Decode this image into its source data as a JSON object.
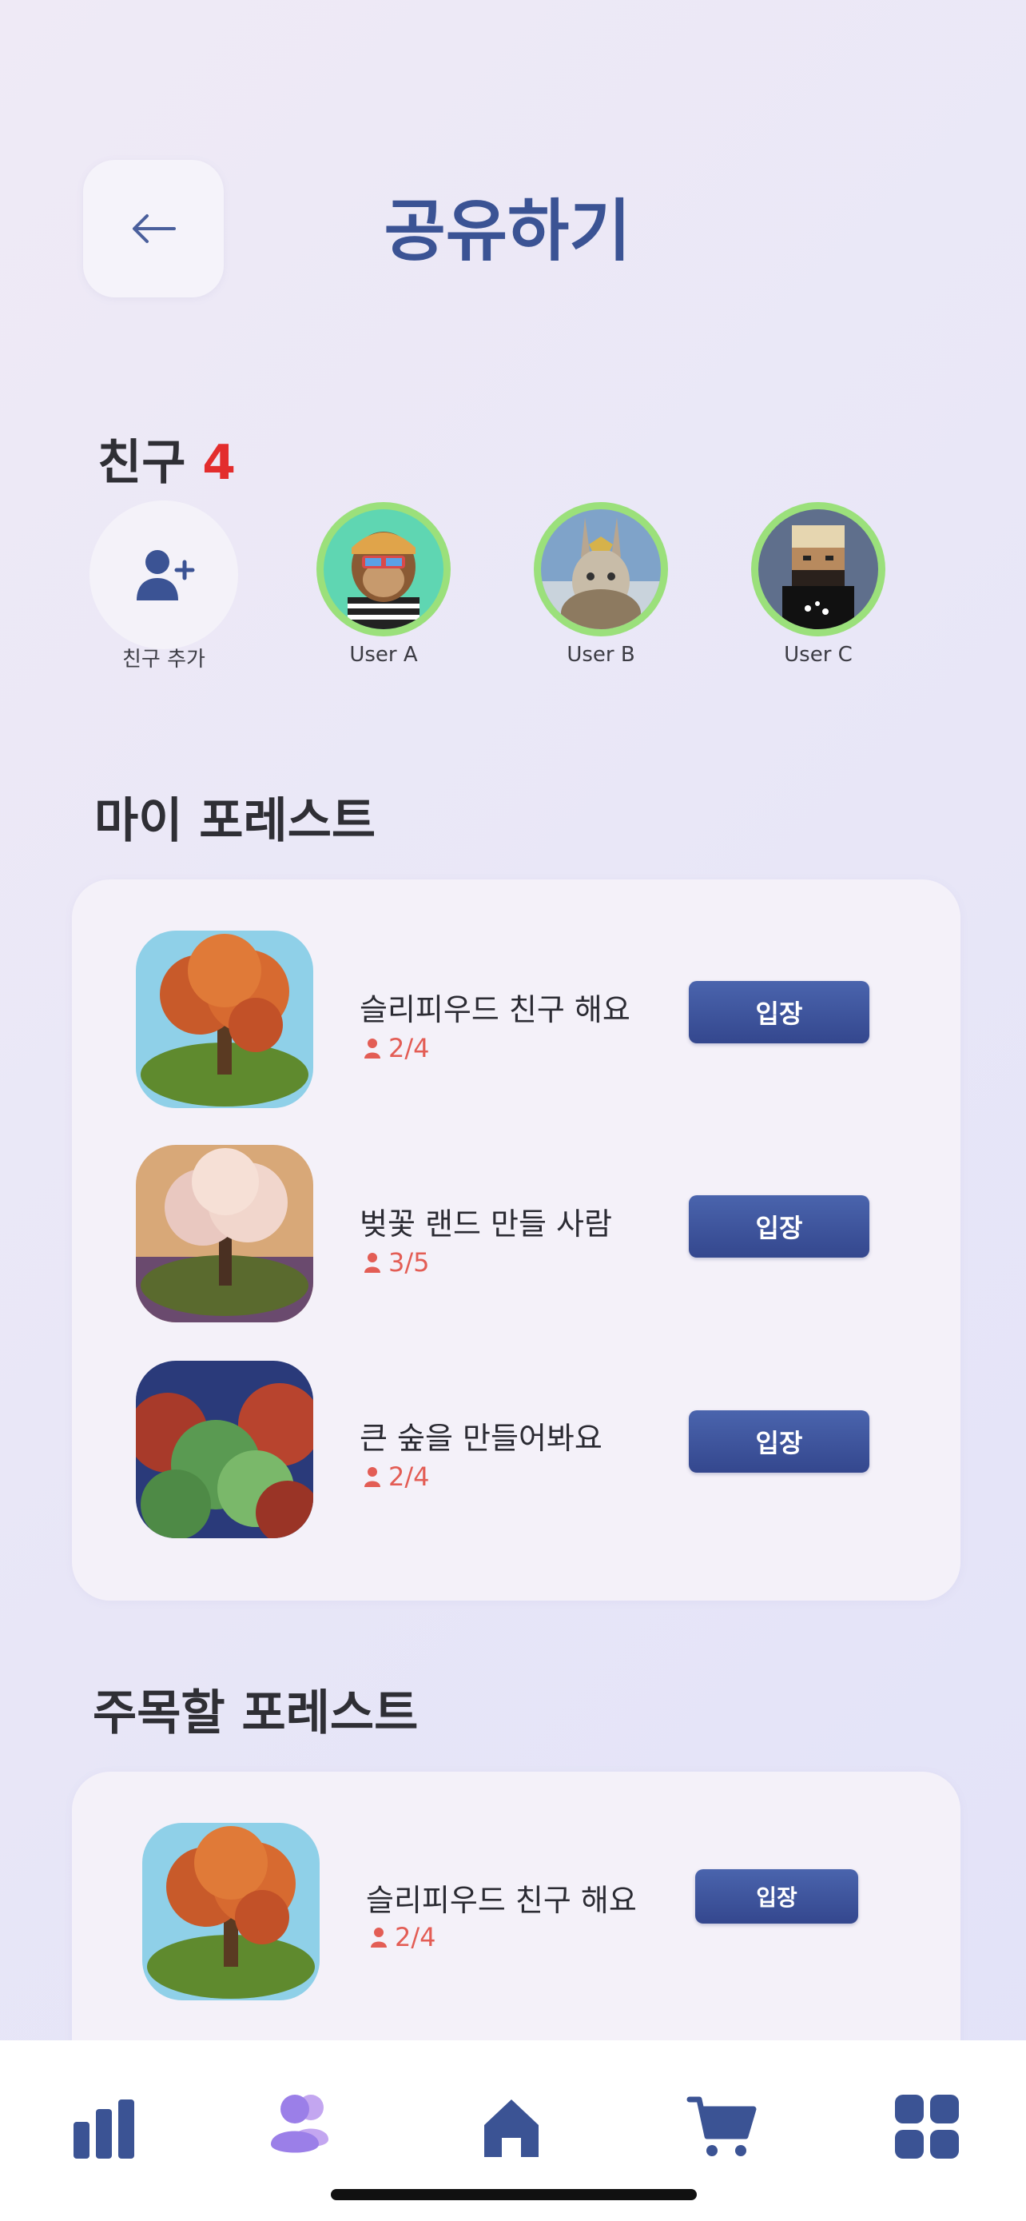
{
  "header": {
    "title": "공유하기",
    "back_icon": "arrow-left-icon"
  },
  "friends": {
    "heading": "친구",
    "count": "4",
    "add_label": "친구 추가",
    "items": [
      {
        "name": "User A"
      },
      {
        "name": "User B"
      },
      {
        "name": "User C"
      }
    ]
  },
  "my_forests": {
    "heading": "마이 포레스트",
    "items": [
      {
        "title": "슬리피우드 친구 해요",
        "members": "2/4",
        "button": "입장"
      },
      {
        "title": "벚꽃 랜드 만들 사람",
        "members": "3/5",
        "button": "입장"
      },
      {
        "title": "큰 숲을 만들어봐요",
        "members": "2/4",
        "button": "입장"
      }
    ]
  },
  "featured_forests": {
    "heading": "주목할 포레스트",
    "items": [
      {
        "title": "슬리피우드 친구 해요",
        "members": "2/4",
        "button": "입장"
      }
    ]
  },
  "tabbar": {
    "tabs": [
      "stats-icon",
      "friends-icon",
      "home-icon",
      "cart-icon",
      "grid-icon"
    ]
  },
  "colors": {
    "accent": "#3b5394",
    "count_red": "#e32d2d",
    "member_red": "#e35d55",
    "avatar_ring": "#9be07b"
  }
}
